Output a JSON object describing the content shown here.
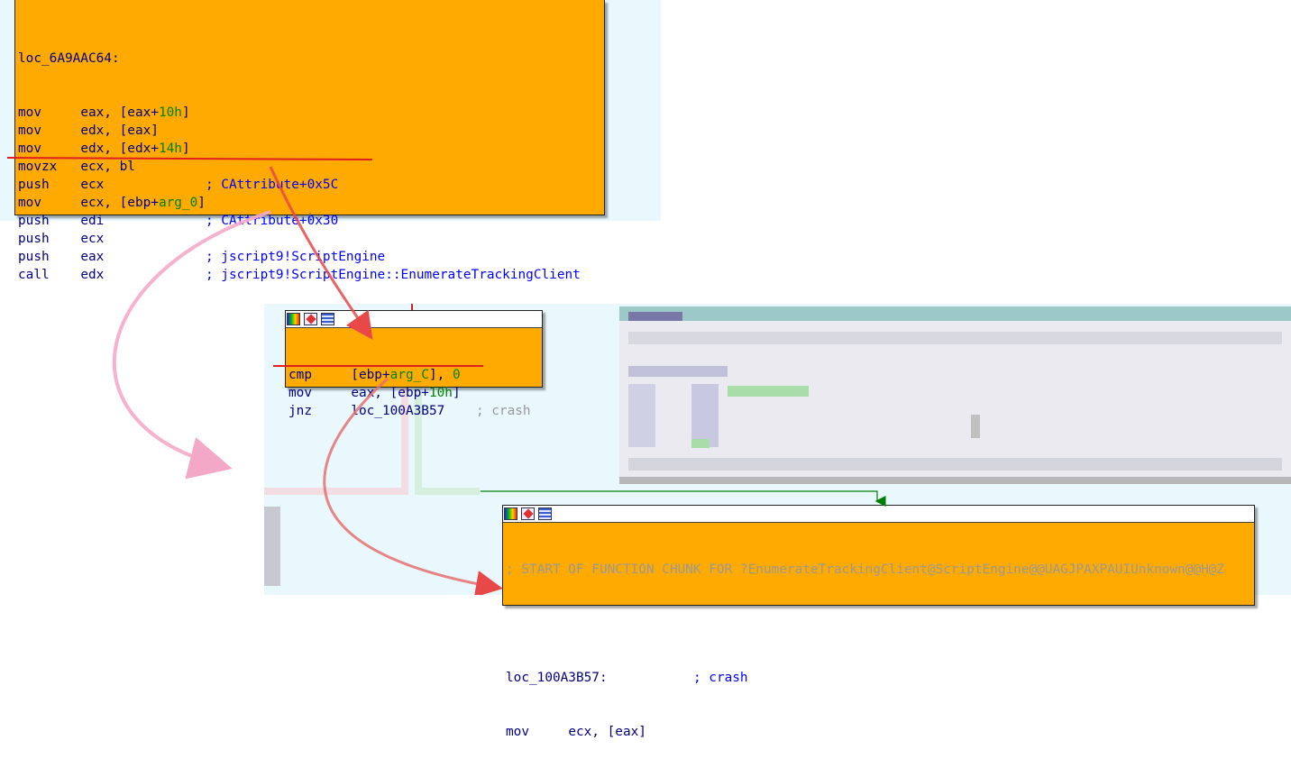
{
  "node_top": {
    "label": "loc_6A9AAC64:",
    "lines": [
      {
        "mn": "mov",
        "ops": [
          {
            "t": "eax, [eax+"
          },
          {
            "t": "10h",
            "c": "num"
          },
          {
            "t": "]"
          }
        ],
        "cmt": ""
      },
      {
        "mn": "mov",
        "ops": [
          {
            "t": "edx, [eax]"
          }
        ],
        "cmt": ""
      },
      {
        "mn": "mov",
        "ops": [
          {
            "t": "edx, [edx+"
          },
          {
            "t": "14h",
            "c": "num"
          },
          {
            "t": "]"
          }
        ],
        "cmt": ""
      },
      {
        "mn": "movzx",
        "ops": [
          {
            "t": "ecx, bl"
          }
        ],
        "cmt": ""
      },
      {
        "mn": "push",
        "ops": [
          {
            "t": "ecx"
          }
        ],
        "cmt": "; CAttribute+0x5C"
      },
      {
        "mn": "mov",
        "ops": [
          {
            "t": "ecx, [ebp+"
          },
          {
            "t": "arg_0",
            "c": "arg"
          },
          {
            "t": "]"
          }
        ],
        "cmt": ""
      },
      {
        "mn": "push",
        "ops": [
          {
            "t": "edi"
          }
        ],
        "cmt": "; CAttribute+0x30"
      },
      {
        "mn": "push",
        "ops": [
          {
            "t": "ecx"
          }
        ],
        "cmt": ""
      },
      {
        "mn": "push",
        "ops": [
          {
            "t": "eax"
          }
        ],
        "cmt": "; jscript9!ScriptEngine"
      },
      {
        "mn": "call",
        "ops": [
          {
            "t": "edx"
          }
        ],
        "cmt": "; jscript9!ScriptEngine::EnumerateTrackingClient"
      }
    ]
  },
  "node_mid": {
    "lines": [
      {
        "mn": "cmp",
        "ops": [
          {
            "t": "[ebp+"
          },
          {
            "t": "arg_C",
            "c": "arg"
          },
          {
            "t": "], "
          },
          {
            "t": "0",
            "c": "num"
          }
        ],
        "cmt": "",
        "gcmt": ""
      },
      {
        "mn": "mov",
        "ops": [
          {
            "t": "eax, [ebp+"
          },
          {
            "t": "10h",
            "c": "num"
          },
          {
            "t": "]"
          }
        ],
        "cmt": "",
        "gcmt": ""
      },
      {
        "mn": "jnz",
        "ops": [
          {
            "t": "loc_100A3B57"
          }
        ],
        "cmt": "",
        "gcmt": "; crash"
      }
    ]
  },
  "node_bottom": {
    "header_comment": "; START OF FUNCTION CHUNK FOR ?EnumerateTrackingClient@ScriptEngine@@UAGJPAXPAUIUnknown@@H@Z",
    "label": "loc_100A3B57:",
    "label_comment": "; crash",
    "lines": [
      {
        "mn": "mov",
        "ops": [
          {
            "t": "ecx, [eax]"
          }
        ],
        "cmt": ""
      }
    ]
  },
  "icons": [
    "graph-overview-icon",
    "edit-node-icon",
    "listing-icon"
  ],
  "colors": {
    "node_fill": "#ffaa00",
    "graph_bg": "#e8f8fc",
    "text": "#000080",
    "number": "#008000",
    "comment": "#0000ff",
    "annotation_red": "#e02020",
    "annotation_pink": "#f4a8c8",
    "branch_green": "#008000"
  }
}
